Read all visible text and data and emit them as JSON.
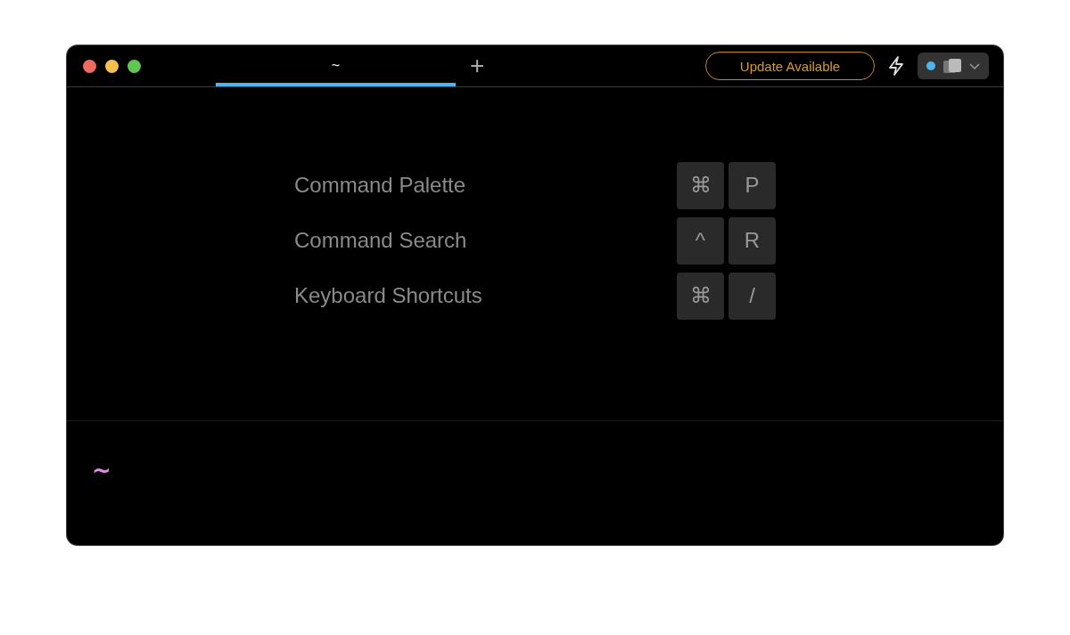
{
  "tabs": [
    {
      "label": "~",
      "selected": true
    }
  ],
  "new_tab": "+",
  "update_button": "Update Available",
  "shortcuts": [
    {
      "label": "Command Palette",
      "keys": [
        "⌘",
        "P"
      ]
    },
    {
      "label": "Command Search",
      "keys": [
        "^",
        "R"
      ]
    },
    {
      "label": "Keyboard Shortcuts",
      "keys": [
        "⌘",
        "/"
      ]
    }
  ],
  "prompt": "~"
}
